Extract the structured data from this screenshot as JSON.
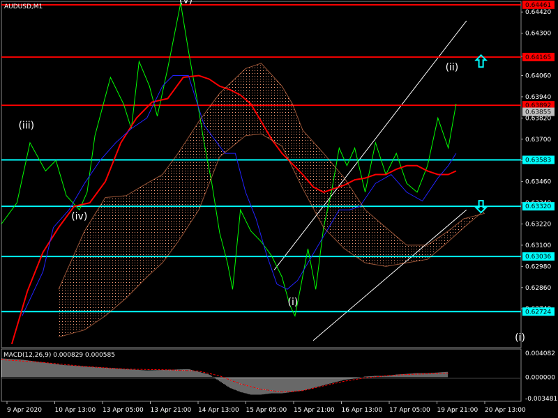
{
  "chart_data": [
    {
      "type": "line",
      "symbol_label": "AUDUSD,M1",
      "price_axis": {
        "range": [
          0.6252,
          0.6448
        ],
        "ticks": [
          "0.64420",
          "0.64300",
          "0.64170",
          "0.64060",
          "0.63940",
          "0.63820",
          "0.63700",
          "0.63580",
          "0.63460",
          "0.63340",
          "0.63220",
          "0.63100",
          "0.62980",
          "0.62860",
          "0.62740"
        ]
      },
      "time_axis": {
        "labels": [
          "9 Apr 2020",
          "10 Apr 13:00",
          "13 Apr 05:00",
          "13 Apr 21:00",
          "14 Apr 13:00",
          "15 Apr 05:00",
          "15 Apr 21:00",
          "16 Apr 13:00",
          "17 Apr 05:00",
          "19 Apr 21:00",
          "20 Apr 13:00"
        ]
      },
      "horizontal_levels": [
        {
          "value": 0.64461,
          "label": "0.64461",
          "color": "#ff0000"
        },
        {
          "value": 0.64165,
          "label": "0.64165",
          "color": "#ff0000"
        },
        {
          "value": 0.63892,
          "label": "0.63892",
          "color": "#ff0000"
        },
        {
          "value": 0.63583,
          "label": "0.63583",
          "color": "#00ffff"
        },
        {
          "value": 0.6332,
          "label": "0.63320",
          "color": "#00ffff"
        },
        {
          "value": 0.63036,
          "label": "0.63036",
          "color": "#00ffff"
        },
        {
          "value": 0.62724,
          "label": "0.62724",
          "color": "#00ffff"
        }
      ],
      "current_price": {
        "value": 0.63855,
        "label": "0.63855"
      },
      "wave_labels": [
        {
          "text": "(v)",
          "x": 0.355,
          "y": 0.6447
        },
        {
          "text": "(iii)",
          "x": 0.048,
          "y": 0.6376
        },
        {
          "text": "(iv)",
          "x": 0.15,
          "y": 0.63245
        },
        {
          "text": "(i)",
          "x": 0.561,
          "y": 0.6276
        },
        {
          "text": "(ii)",
          "x": 0.867,
          "y": 0.6409
        },
        {
          "text": "(i)",
          "x": 0.998,
          "y": 0.6256
        }
      ],
      "arrows": [
        {
          "direction": "up",
          "x": 0.923,
          "y": 0.6414,
          "color": "#00ffff"
        },
        {
          "direction": "down",
          "x": 0.923,
          "y": 0.6332,
          "color": "#00ffff"
        }
      ],
      "channel": [
        {
          "x1": 0.525,
          "y1": 0.6296,
          "x2": 0.895,
          "y2": 0.6437
        },
        {
          "x1": 0.6,
          "y1": 0.6256,
          "x2": 0.895,
          "y2": 0.633
        }
      ],
      "series": [
        {
          "color": "#00ff00",
          "x": [
            0.0,
            0.03,
            0.055,
            0.085,
            0.105,
            0.125,
            0.15,
            0.165,
            0.18,
            0.21,
            0.235,
            0.25,
            0.265,
            0.285,
            0.3,
            0.32,
            0.345,
            0.36,
            0.375,
            0.39,
            0.405,
            0.42,
            0.435,
            0.445,
            0.46,
            0.48,
            0.5,
            0.52,
            0.54,
            0.555,
            0.565,
            0.575,
            0.59,
            0.605,
            0.62,
            0.635,
            0.65,
            0.665,
            0.68,
            0.7,
            0.72,
            0.74,
            0.76,
            0.78,
            0.8,
            0.82,
            0.84,
            0.86,
            0.875
          ],
          "y": [
            0.6322,
            0.6334,
            0.6368,
            0.6352,
            0.6358,
            0.6338,
            0.633,
            0.634,
            0.6372,
            0.6405,
            0.639,
            0.6376,
            0.6414,
            0.64,
            0.6383,
            0.641,
            0.6447,
            0.642,
            0.6395,
            0.6368,
            0.6345,
            0.6317,
            0.63,
            0.6285,
            0.633,
            0.6318,
            0.6312,
            0.6304,
            0.6292,
            0.6276,
            0.627,
            0.6285,
            0.6308,
            0.6285,
            0.632,
            0.634,
            0.6365,
            0.6355,
            0.6365,
            0.634,
            0.6368,
            0.635,
            0.6362,
            0.6345,
            0.634,
            0.6355,
            0.6382,
            0.6365,
            0.639
          ]
        },
        {
          "color": "#ff0000",
          "x": [
            0.02,
            0.05,
            0.08,
            0.11,
            0.14,
            0.17,
            0.2,
            0.23,
            0.26,
            0.29,
            0.32,
            0.35,
            0.38,
            0.4,
            0.42,
            0.44,
            0.46,
            0.48,
            0.5,
            0.52,
            0.54,
            0.56,
            0.58,
            0.6,
            0.62,
            0.64,
            0.66,
            0.68,
            0.7,
            0.72,
            0.74,
            0.76,
            0.78,
            0.8,
            0.82,
            0.84,
            0.86,
            0.875
          ],
          "y": [
            0.6254,
            0.6284,
            0.6306,
            0.632,
            0.6332,
            0.6334,
            0.6346,
            0.6368,
            0.6382,
            0.6391,
            0.6393,
            0.6405,
            0.6406,
            0.6404,
            0.64,
            0.6398,
            0.6395,
            0.639,
            0.638,
            0.637,
            0.6362,
            0.6356,
            0.635,
            0.6343,
            0.634,
            0.6342,
            0.6344,
            0.6347,
            0.6348,
            0.635,
            0.635,
            0.6353,
            0.6355,
            0.6355,
            0.6352,
            0.635,
            0.635,
            0.6352
          ]
        },
        {
          "color": "#2222ff",
          "x": [
            0.04,
            0.08,
            0.1,
            0.13,
            0.16,
            0.19,
            0.22,
            0.25,
            0.28,
            0.31,
            0.33,
            0.36,
            0.39,
            0.41,
            0.43,
            0.45,
            0.47,
            0.49,
            0.51,
            0.53,
            0.55,
            0.57,
            0.59,
            0.61,
            0.63,
            0.65,
            0.67,
            0.69,
            0.72,
            0.75,
            0.78,
            0.81,
            0.84,
            0.86,
            0.875
          ],
          "y": [
            0.627,
            0.6295,
            0.632,
            0.633,
            0.6345,
            0.6358,
            0.6368,
            0.6376,
            0.6382,
            0.64,
            0.6406,
            0.6406,
            0.6378,
            0.637,
            0.6362,
            0.6362,
            0.634,
            0.6325,
            0.6305,
            0.6288,
            0.6285,
            0.629,
            0.63,
            0.631,
            0.632,
            0.633,
            0.633,
            0.6332,
            0.6345,
            0.635,
            0.634,
            0.6335,
            0.6348,
            0.6355,
            0.6362
          ]
        },
        {
          "color": "#ff8c5a",
          "x": [
            0.11,
            0.16,
            0.2,
            0.24,
            0.28,
            0.31,
            0.34,
            0.38,
            0.42,
            0.47,
            0.5,
            0.54,
            0.56,
            0.58,
            0.62,
            0.66,
            0.7,
            0.74,
            0.78,
            0.82,
            0.86,
            0.89,
            0.93
          ],
          "y": [
            0.6285,
            0.6318,
            0.6337,
            0.6338,
            0.6345,
            0.635,
            0.6362,
            0.638,
            0.6396,
            0.641,
            0.6413,
            0.64,
            0.639,
            0.6375,
            0.6362,
            0.6348,
            0.633,
            0.632,
            0.631,
            0.631,
            0.6318,
            0.6325,
            0.6328
          ]
        },
        {
          "color": "#ff8c5a",
          "x": [
            0.11,
            0.16,
            0.2,
            0.24,
            0.28,
            0.31,
            0.34,
            0.38,
            0.42,
            0.47,
            0.5,
            0.54,
            0.56,
            0.58,
            0.62,
            0.66,
            0.7,
            0.74,
            0.78,
            0.82,
            0.86,
            0.89,
            0.93
          ],
          "y": [
            0.6258,
            0.6262,
            0.627,
            0.628,
            0.6292,
            0.63,
            0.6312,
            0.633,
            0.636,
            0.6372,
            0.6373,
            0.6366,
            0.6354,
            0.6342,
            0.632,
            0.6308,
            0.63,
            0.6298,
            0.63,
            0.6302,
            0.6312,
            0.632,
            0.633
          ]
        }
      ]
    },
    {
      "type": "bar",
      "title": "MACD(12,26,9) 0.000829 0.000585",
      "y_ticks": [
        "0.004082",
        "0.000000",
        "-0.003481"
      ],
      "ylim": [
        -0.003481,
        0.004082
      ],
      "histogram": {
        "x": [
          0.0,
          0.04,
          0.08,
          0.12,
          0.16,
          0.2,
          0.24,
          0.28,
          0.32,
          0.36,
          0.38,
          0.4,
          0.42,
          0.44,
          0.46,
          0.48,
          0.5,
          0.52,
          0.54,
          0.56,
          0.58,
          0.6,
          0.62,
          0.64,
          0.66,
          0.68,
          0.7,
          0.72,
          0.74,
          0.76,
          0.78,
          0.8,
          0.82,
          0.84,
          0.86
        ],
        "values": [
          0.0028,
          0.0026,
          0.0022,
          0.0018,
          0.0016,
          0.0014,
          0.0012,
          0.001,
          0.0011,
          0.0012,
          0.0008,
          0.0004,
          -0.0006,
          -0.0016,
          -0.0022,
          -0.0026,
          -0.0026,
          -0.0024,
          -0.0024,
          -0.0022,
          -0.002,
          -0.0016,
          -0.0012,
          -0.0008,
          -0.0004,
          -0.0002,
          0.0001,
          0.0002,
          0.0002,
          0.0004,
          0.0005,
          0.0006,
          0.0006,
          0.0007,
          0.0008
        ]
      },
      "signal": {
        "color": "#ff0000",
        "x": [
          0.0,
          0.08,
          0.16,
          0.24,
          0.32,
          0.38,
          0.42,
          0.46,
          0.5,
          0.54,
          0.58,
          0.62,
          0.66,
          0.7,
          0.74,
          0.78,
          0.82,
          0.86
        ],
        "values": [
          0.0026,
          0.0022,
          0.0016,
          0.0012,
          0.0011,
          0.0009,
          0.0002,
          -0.001,
          -0.0018,
          -0.0022,
          -0.002,
          -0.0013,
          -0.0006,
          -0.0001,
          0.0002,
          0.0004,
          0.0005,
          0.0006
        ]
      }
    }
  ]
}
